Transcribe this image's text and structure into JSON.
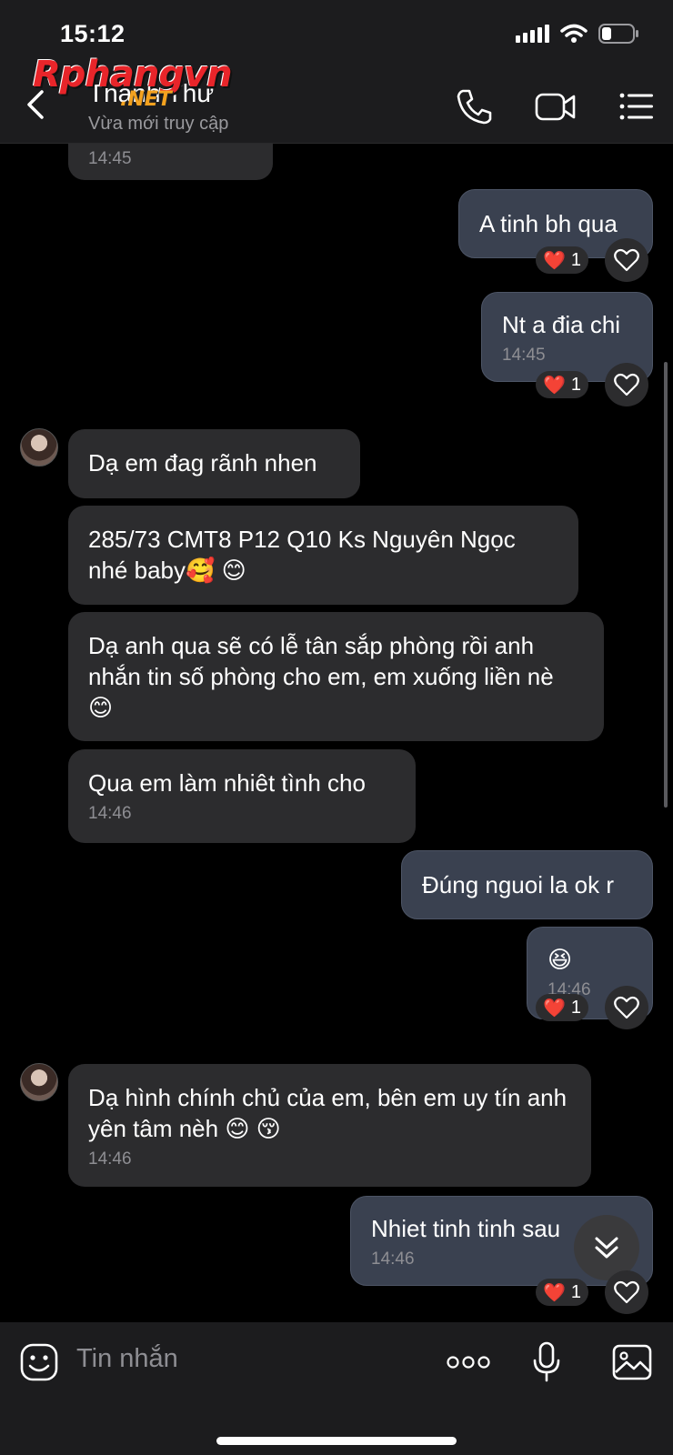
{
  "status_bar": {
    "time": "15:12"
  },
  "watermark": {
    "brand": "Rphangvn",
    "suffix": ".NET"
  },
  "header": {
    "contact_name": "Thanh Thư",
    "contact_status": "Vừa mới truy cập",
    "icons": [
      "back-icon",
      "phone-icon",
      "video-icon",
      "menu-icon"
    ]
  },
  "messages": [
    {
      "dir": "in",
      "time": "14:45"
    },
    {
      "dir": "out",
      "text": "A tinh bh qua",
      "reaction": {
        "emoji": "❤️",
        "count": "1"
      }
    },
    {
      "dir": "out",
      "text": "Nt a đia chi",
      "time": "14:45",
      "reaction": {
        "emoji": "❤️",
        "count": "1"
      }
    },
    {
      "dir": "in",
      "text": "Dạ em đag rãnh nhen"
    },
    {
      "dir": "in",
      "text": "285/73 CMT8 P12 Q10 Ks Nguyên Ngọc nhé baby🥰 😊"
    },
    {
      "dir": "in",
      "text": "Dạ anh qua sẽ có lễ tân sắp phòng rồi anh nhắn tin số phòng cho em, em xuống liền nè 😊"
    },
    {
      "dir": "in",
      "text": "Qua em làm nhiêt tình cho",
      "time": "14:46"
    },
    {
      "dir": "out",
      "text": "Đúng nguoi la ok r"
    },
    {
      "dir": "out",
      "text": "😆",
      "time": "14:46",
      "reaction": {
        "emoji": "❤️",
        "count": "1"
      }
    },
    {
      "dir": "in",
      "text": "Dạ hình chính chủ của em, bên em uy tín anh yên tâm nèh 😊 😚",
      "time": "14:46"
    },
    {
      "dir": "out",
      "text": "Nhiet tinh tinh sau",
      "time": "14:46",
      "reaction": {
        "emoji": "❤️",
        "count": "1"
      }
    }
  ],
  "composer": {
    "placeholder": "Tin nhắn"
  },
  "colors": {
    "background": "#000000",
    "incoming_bubble": "#2c2c2e",
    "outgoing_bubble": "#3a4150",
    "heart": "#e53b45"
  }
}
